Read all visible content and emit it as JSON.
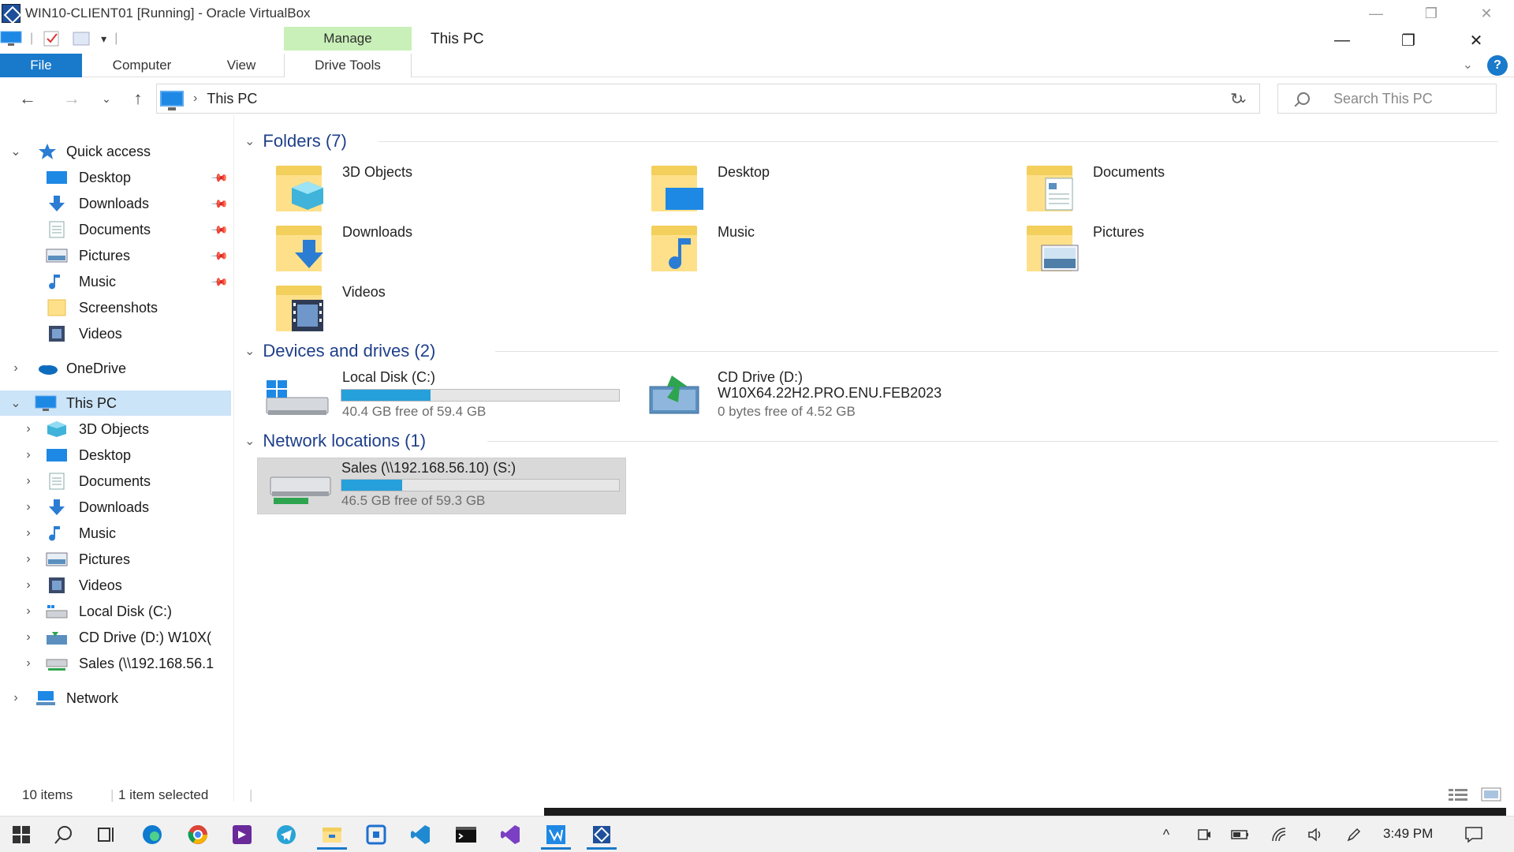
{
  "vbox": {
    "title": "WIN10-CLIENT01 [Running] - Oracle VirtualBox"
  },
  "explorer": {
    "title": "This PC",
    "contextual_tab": "Manage",
    "ribbon_tabs": [
      "File",
      "Computer",
      "View",
      "Drive Tools"
    ]
  },
  "address": {
    "path": "This PC",
    "search_placeholder": "Search This PC"
  },
  "nav": {
    "quick_access": "Quick access",
    "qa_items": [
      {
        "label": "Desktop",
        "pinned": true
      },
      {
        "label": "Downloads",
        "pinned": true
      },
      {
        "label": "Documents",
        "pinned": true
      },
      {
        "label": "Pictures",
        "pinned": true
      },
      {
        "label": "Music",
        "pinned": true
      },
      {
        "label": "Screenshots",
        "pinned": false
      },
      {
        "label": "Videos",
        "pinned": false
      }
    ],
    "onedrive": "OneDrive",
    "this_pc": "This PC",
    "pc_items": [
      "3D Objects",
      "Desktop",
      "Documents",
      "Downloads",
      "Music",
      "Pictures",
      "Videos",
      "Local Disk (C:)",
      "CD Drive (D:) W10X(",
      "Sales (\\\\192.168.56.1"
    ],
    "network": "Network"
  },
  "content": {
    "folders_header": "Folders (7)",
    "folders": [
      "3D Objects",
      "Desktop",
      "Documents",
      "Downloads",
      "Music",
      "Pictures",
      "Videos"
    ],
    "devices_header": "Devices and drives (2)",
    "local_disk": {
      "name": "Local Disk (C:)",
      "free": "40.4 GB free of 59.4 GB",
      "used_fraction": 0.32
    },
    "cd_drive": {
      "name": "CD Drive (D:)",
      "label": "W10X64.22H2.PRO.ENU.FEB2023",
      "free": "0 bytes free of 4.52 GB"
    },
    "network_header": "Network locations (1)",
    "sales_drive": {
      "name": "Sales (\\\\192.168.56.10) (S:)",
      "free": "46.5 GB free of 59.3 GB",
      "used_fraction": 0.22
    }
  },
  "status": {
    "items": "10 items",
    "selected": "1 item selected"
  },
  "taskbar": {
    "time": "3:49 PM"
  },
  "colors": {
    "accent": "#1979ca",
    "manage_tab": "#c9f0b8",
    "selection": "#cce4f7",
    "group_header": "#1e3f8a",
    "drive_fill": "#26a0da"
  }
}
